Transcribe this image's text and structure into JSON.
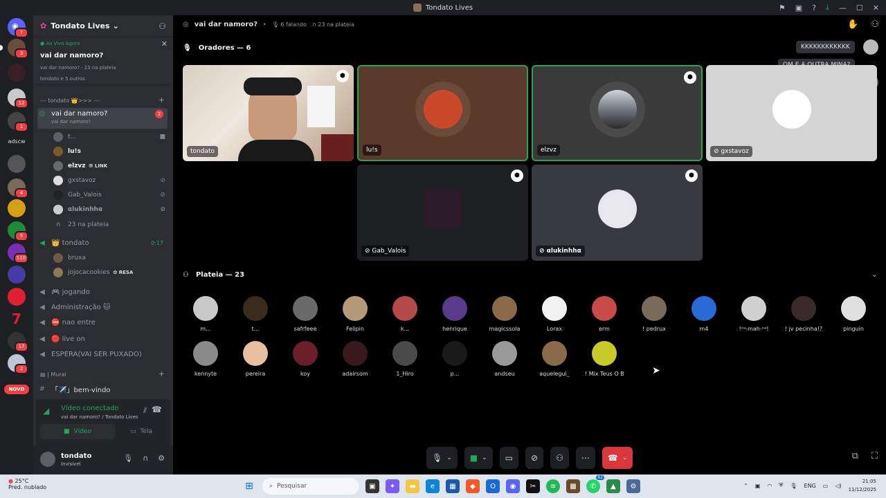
{
  "window": {
    "title": "Tondato Lives"
  },
  "rail": {
    "text_server": "adscw",
    "novo_label": "NOVO",
    "badges": [
      "7",
      "3",
      "12",
      "1",
      "4",
      "6",
      "5",
      "110",
      "17",
      "2"
    ]
  },
  "sidebar": {
    "server_name": "Tondato Lives",
    "live_card": {
      "tag": "Ao Vivo Agora",
      "title": "vai dar namoro?",
      "sub": "vai dar namoro? · 23 na plateia",
      "sub2": "tondato e 5 outros"
    },
    "category1": "--- tondato 👑>>> ---",
    "stage_channel": {
      "name": "vai dar namoro?",
      "topic": "vai dar namoro?",
      "badge": "2"
    },
    "stage_users": [
      {
        "name": "t..."
      },
      {
        "name": "lu!s"
      },
      {
        "name": "elzvz",
        "tag": "LINK"
      },
      {
        "name": "gxstavoz"
      },
      {
        "name": "Gab_Valois"
      },
      {
        "name": "αlukinhhα"
      }
    ],
    "audience_count": "23 na plateia",
    "voice_channel": {
      "name": "👑 tondato",
      "timer": "0:17"
    },
    "voice_users": [
      {
        "name": "bruxa"
      },
      {
        "name": "jojocacookies",
        "tag": "RESA"
      }
    ],
    "channels": [
      "🎮 jogando",
      "Administração 🐱",
      "⛔ nao entre",
      "🔴 live on",
      "ESPERA(VAI SER PUXADO)"
    ],
    "category2": "| Mural",
    "text_channel": "「✈️」bem-vindo",
    "voice_panel": {
      "status": "Vídeo conectado",
      "sub": "vai dar namoro? / Tondato Lives",
      "video_label": "Vídeo",
      "screen_label": "Tela"
    },
    "user": {
      "name": "tondato",
      "status": "Invisível"
    }
  },
  "stage": {
    "title": "vai dar namoro?",
    "speaking": "6 falando",
    "audience": "23 na plateia",
    "speakers_title": "Oradores — 6",
    "audience_title": "Plateia — 23",
    "speakers": [
      "tondato",
      "lu!s",
      "elzvz",
      "gxstavoz",
      "Gab_Valois",
      "αlukinhhα"
    ],
    "bubbles": [
      "KKKKKKKKKKKK",
      "QM E A OUTRA MINA?"
    ],
    "audience_members": [
      "m...",
      "t...",
      "safrfeee",
      "Felipin",
      "k...",
      "henrique",
      "magicssola",
      "Lorax",
      "erm",
      "! pedrux",
      "m4",
      "!ᵒᵃ-mah-ᵒᵃ!",
      "! jv pecinha!?",
      "pinguin",
      "kennyte",
      "pereira",
      "koy",
      "adairsom",
      "1_Hiro",
      "p...",
      "andseu",
      "aquelegui_",
      "! Mix Teus O B..."
    ]
  },
  "taskbar": {
    "weather_temp": "25°C",
    "weather_desc": "Pred. nublado",
    "search_placeholder": "Pesquisar",
    "lang": "ENG",
    "time": "21:05",
    "date": "11/12/2025",
    "whatsapp_badge": "62"
  },
  "colors": {
    "accent_green": "#23a55a",
    "danger_red": "#da373c",
    "sidebar_bg": "#2b2d31",
    "rail_bg": "#1e1f22"
  }
}
